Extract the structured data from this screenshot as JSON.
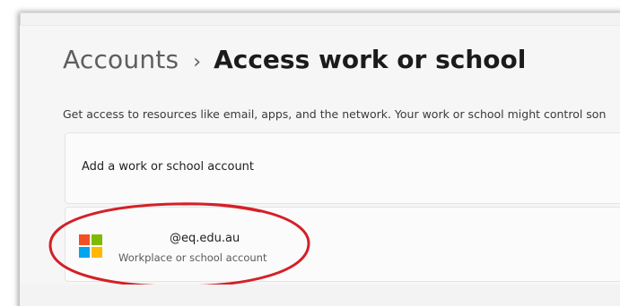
{
  "breadcrumb": {
    "parent": "Accounts",
    "separator": "›",
    "current": "Access work or school"
  },
  "description": "Get access to resources like email, apps, and the network. Your work or school might control son",
  "add_account": {
    "label": "Add a work or school account"
  },
  "account": {
    "email": "@eq.edu.au",
    "type": "Workplace or school account",
    "logo_icon": "microsoft-logo-icon",
    "logo_colors": [
      "#f25022",
      "#7fba00",
      "#00a4ef",
      "#ffb900"
    ]
  },
  "annotation": {
    "shape": "hand-drawn-ellipse",
    "color": "#d42027"
  }
}
